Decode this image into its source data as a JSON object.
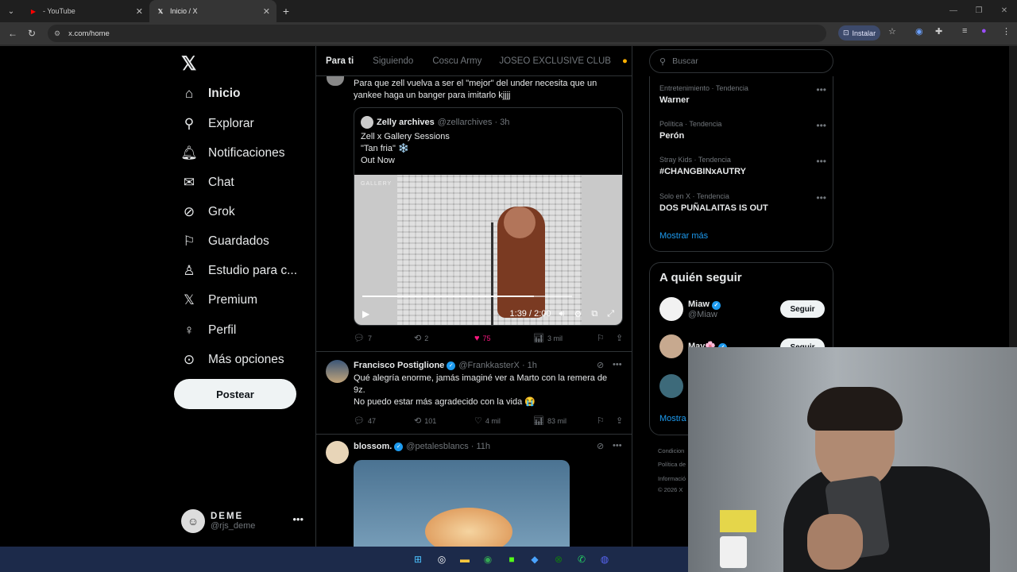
{
  "browser": {
    "tabs": [
      {
        "title": "- YouTube",
        "favicon": "youtube-icon",
        "color": "#ff0000"
      },
      {
        "title": "Inicio / X",
        "favicon": "x-icon",
        "active": true
      }
    ],
    "url": "x.com/home",
    "install_label": "Instalar"
  },
  "nav": {
    "items": [
      {
        "label": "Inicio",
        "icon": "home-icon"
      },
      {
        "label": "Explorar",
        "icon": "search-icon"
      },
      {
        "label": "Notificaciones",
        "icon": "bell-icon"
      },
      {
        "label": "Chat",
        "icon": "mail-icon"
      },
      {
        "label": "Grok",
        "icon": "grok-icon"
      },
      {
        "label": "Guardados",
        "icon": "bookmark-icon"
      },
      {
        "label": "Estudio para c...",
        "icon": "studio-icon"
      },
      {
        "label": "Premium",
        "icon": "x-icon"
      },
      {
        "label": "Perfil",
        "icon": "person-icon"
      },
      {
        "label": "Más opciones",
        "icon": "more-circle-icon"
      }
    ],
    "post_label": "Postear",
    "account": {
      "name": "DEME",
      "handle": "@rjs_deme"
    }
  },
  "feed": {
    "tabs": [
      "Para ti",
      "Siguiendo",
      "Coscu Army",
      "JOSEO EXCLUSIVE CLUB"
    ],
    "tweets": [
      {
        "text_line1": "Para que zell vuelva a ser el \"mejor\" del under necesita que un",
        "text_line2": "yankee haga un banger  para imitarlo kjjjj",
        "quote": {
          "name": "Zelly archives",
          "handle": "@zellarchives · 3h",
          "line1": "Zell x Gallery Sessions",
          "line2": "\"Tan fria\" ❄️",
          "line3": "Out Now",
          "video_label": "GALLERY",
          "video_time": "1:39 / 2:00",
          "progress": 0.82
        },
        "replies": "7",
        "reposts": "2",
        "likes": "75",
        "views": "3 mil"
      },
      {
        "name": "Francisco Postiglione",
        "handle": "@FrankkasterX · 1h",
        "line1": "Qué alegría enorme, jamás imaginé ver a Marto con la remera de",
        "line2": "9z.",
        "line3": "No puedo estar más agradecido con la vida 😭",
        "replies": "47",
        "reposts": "101",
        "likes": "4 mil",
        "views": "83 mil"
      },
      {
        "name": "blossom.",
        "handle": "@petalesblancs · 11h"
      }
    ]
  },
  "sidebar": {
    "search_placeholder": "Buscar",
    "trends": [
      {
        "context": "Entretenimiento · Tendencia",
        "title": "Warner"
      },
      {
        "context": "Política · Tendencia",
        "title": "Perón"
      },
      {
        "context": "Stray Kids · Tendencia",
        "title": "#CHANGBINxAUTRY"
      },
      {
        "context": "Solo en X · Tendencia",
        "title": "DOS PUÑALAITAS IS OUT"
      }
    ],
    "show_more": "Mostrar más",
    "who_to_follow_title": "A quién seguir",
    "follow": [
      {
        "name": "Miaw",
        "handle": "@Miaw",
        "button": "Seguir"
      },
      {
        "name": "May🌸",
        "handle": "",
        "button": "Seguir"
      }
    ],
    "show_more2": "Mostra",
    "legal": [
      "Condicion",
      "Política de",
      "Informació",
      "© 2026 X"
    ]
  },
  "colors": {
    "accent": "#1d9bf0",
    "like": "#f91880",
    "bg": "#000000"
  }
}
